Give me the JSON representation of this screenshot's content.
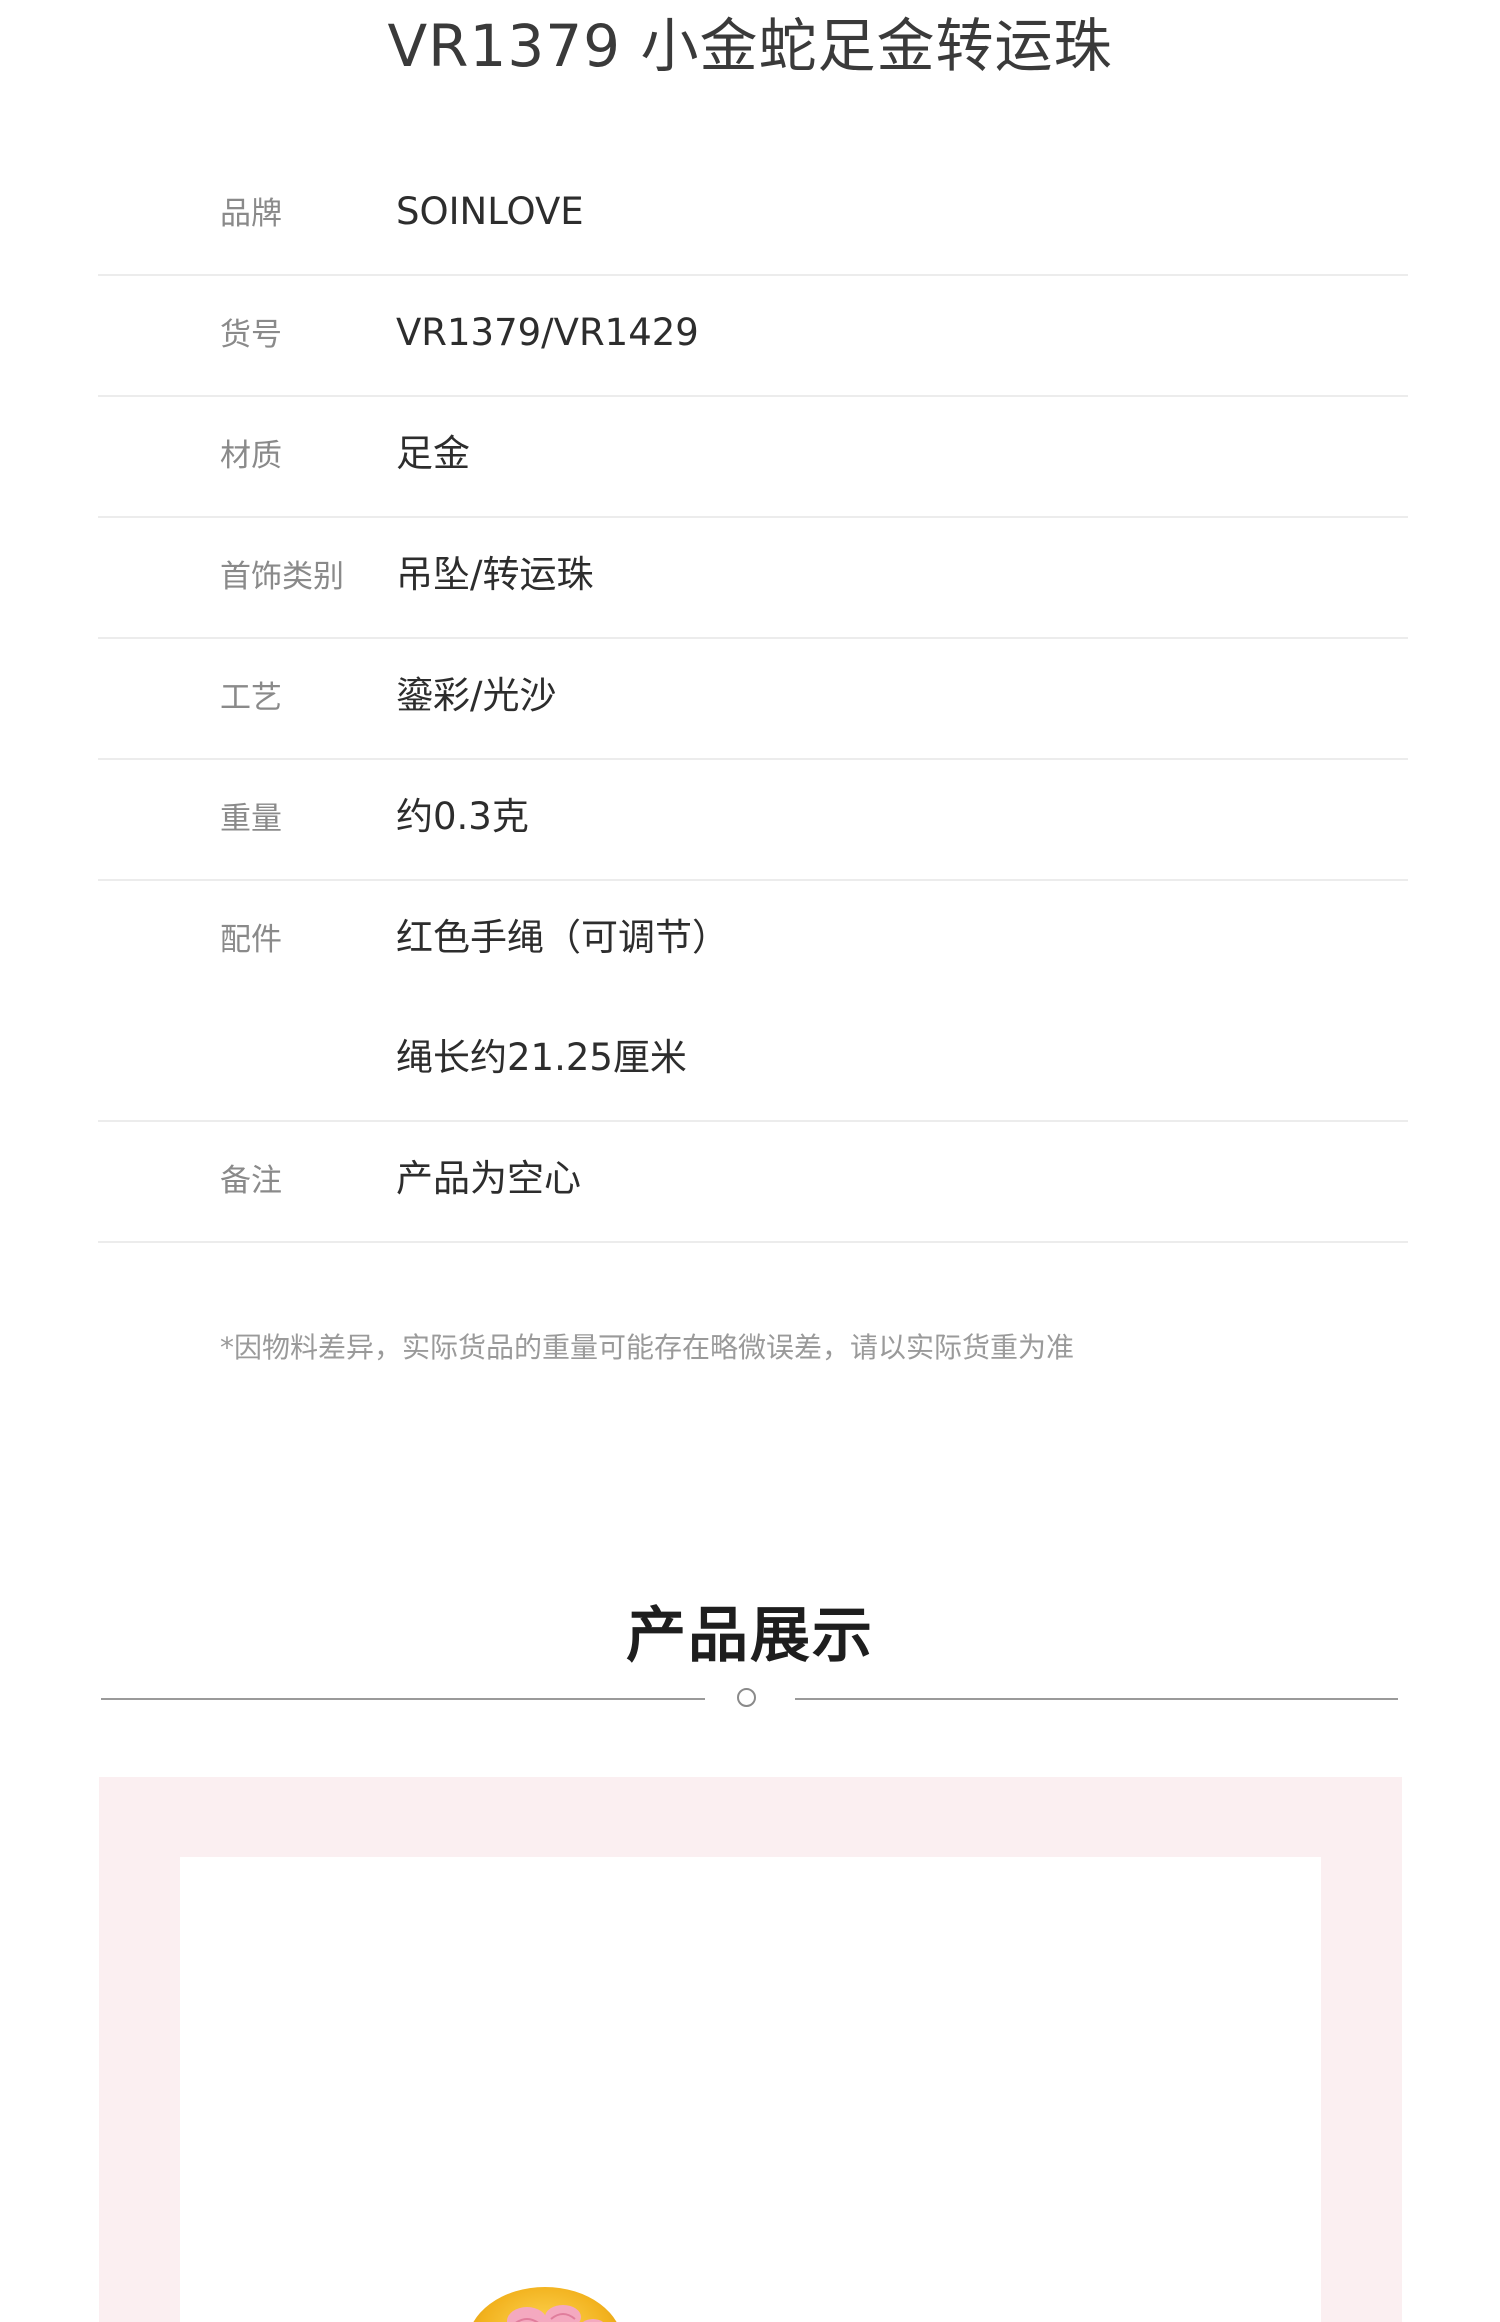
{
  "title": "VR1379 小金蛇足金转运珠",
  "specs": [
    {
      "label": "品牌",
      "values": [
        "SOINLOVE"
      ]
    },
    {
      "label": "货号",
      "values": [
        "VR1379/VR1429"
      ]
    },
    {
      "label": "材质",
      "values": [
        "足金"
      ]
    },
    {
      "label": "首饰类别",
      "values": [
        "吊坠/转运珠"
      ]
    },
    {
      "label": "工艺",
      "values": [
        "鎏彩/光沙"
      ]
    },
    {
      "label": "重量",
      "values": [
        "约0.3克"
      ]
    },
    {
      "label": "配件",
      "values": [
        "红色手绳（可调节）",
        "绳长约21.25厘米"
      ]
    },
    {
      "label": "备注",
      "values": [
        "产品为空心"
      ]
    }
  ],
  "note": "*因物料差异，实际货品的重量可能存在略微误差，请以实际货重为准",
  "section": {
    "title": "产品展示"
  },
  "colors": {
    "divider": "#ececec",
    "frame_bg": "#fbeff1",
    "gold": "#f2b21e",
    "enamel_pink": "#f4a9c0"
  }
}
